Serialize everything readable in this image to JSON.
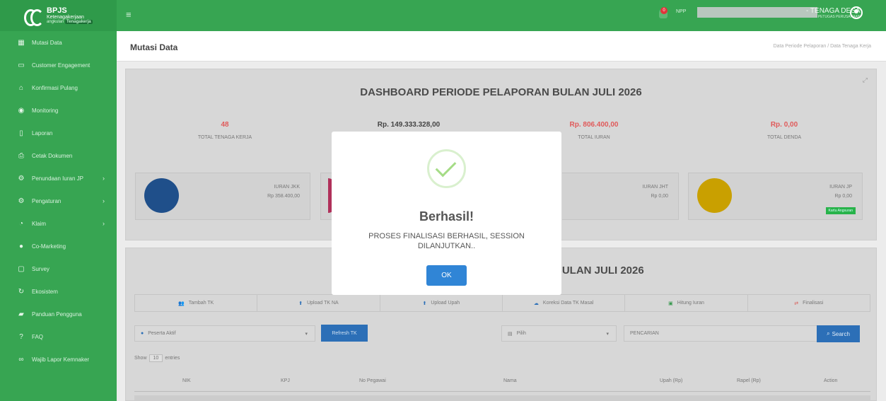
{
  "brand": {
    "name": "BPJS",
    "sub": "Ketenagakerjaan",
    "tag_prefix": "angkulan",
    "tag": "Tenagakerja"
  },
  "sidebar": {
    "items": [
      {
        "label": "Mutasi Data",
        "icon": "calendar-icon"
      },
      {
        "label": "Customer Engagement",
        "icon": "chat-icon"
      },
      {
        "label": "Konfirmasi Pulang",
        "icon": "home-icon"
      },
      {
        "label": "Monitoring",
        "icon": "dashboard-icon"
      },
      {
        "label": "Laporan",
        "icon": "document-icon"
      },
      {
        "label": "Cetak Dokumen",
        "icon": "print-icon"
      },
      {
        "label": "Penundaan Iuran JP",
        "icon": "gear-icon",
        "arrow": "›"
      },
      {
        "label": "Pengaturan",
        "icon": "gear-icon",
        "arrow": "›"
      },
      {
        "label": "Klaim",
        "icon": "clock-icon",
        "arrow": "›"
      },
      {
        "label": "Co-Marketing",
        "icon": "circle-icon"
      },
      {
        "label": "Survey",
        "icon": "clipboard-icon"
      },
      {
        "label": "Ekosistem",
        "icon": "refresh-icon"
      },
      {
        "label": "Panduan Pengguna",
        "icon": "book-icon"
      },
      {
        "label": "FAQ",
        "icon": "question-icon"
      },
      {
        "label": "Wajib Lapor Kemnaker",
        "icon": "link-icon"
      }
    ]
  },
  "topbar": {
    "menu_icon": "≡",
    "notif_count": "0",
    "npp_label": "NPP",
    "user": "- TENAGA DESA",
    "role": "PETUGAS PERUSAHAAN"
  },
  "header": {
    "title": "Mutasi Data",
    "breadcrumb": "Data Periode Pelaporan  /  Data Tenaga Kerja"
  },
  "dashboard": {
    "title": "DASHBOARD PERIODE PELAPORAN BULAN JULI 2026",
    "expand_icon": "⤢",
    "stats": [
      {
        "value": "48",
        "label": "TOTAL TENAGA KERJA",
        "color": "#e05a5a"
      },
      {
        "value": "Rp. 149.333.328,00",
        "label": "",
        "color": "#444444"
      },
      {
        "value": "Rp. 806.400,00",
        "label": "TOTAL IURAN",
        "color": "#e05a5a"
      },
      {
        "value": "Rp. 0,00",
        "label": "TOTAL DENDA",
        "color": "#e05a5a"
      }
    ],
    "iuran": [
      {
        "title": "IURAN JKK",
        "value": "Rp 358.400,00",
        "color": "#1f4f8a"
      },
      {
        "title": "IURAN JHT",
        "value": "Rp 0,00",
        "color": "#c9a000"
      },
      {
        "title": "IURAN JP",
        "value": "Rp 0,00",
        "color": "#c9a000",
        "badge": "Kartu Angsuran"
      }
    ]
  },
  "table": {
    "title": "BULAN JULI 2026",
    "actions": [
      "Tambah TK",
      "Upload TK NA",
      "Upload Upah",
      "Koreksi Data TK Masal",
      "Hitung Iuran",
      "Finalisasi"
    ],
    "status_select": "Peserta Aktif",
    "refresh_label": "Refresh TK",
    "pilih": "Pilih",
    "search_placeholder": "PENCARIAN",
    "search_label": "Search",
    "show_prefix": "Show",
    "show_value": "10",
    "show_suffix": "entries",
    "columns": [
      "NIK",
      "KPJ",
      "No Pegawai",
      "Nama",
      "Upah (Rp)",
      "Rapel (Rp)",
      "Action"
    ]
  },
  "modal": {
    "title": "Berhasil!",
    "text": "PROSES FINALISASI BERHASIL, SESSION DILANJUTKAN..",
    "ok": "OK"
  }
}
